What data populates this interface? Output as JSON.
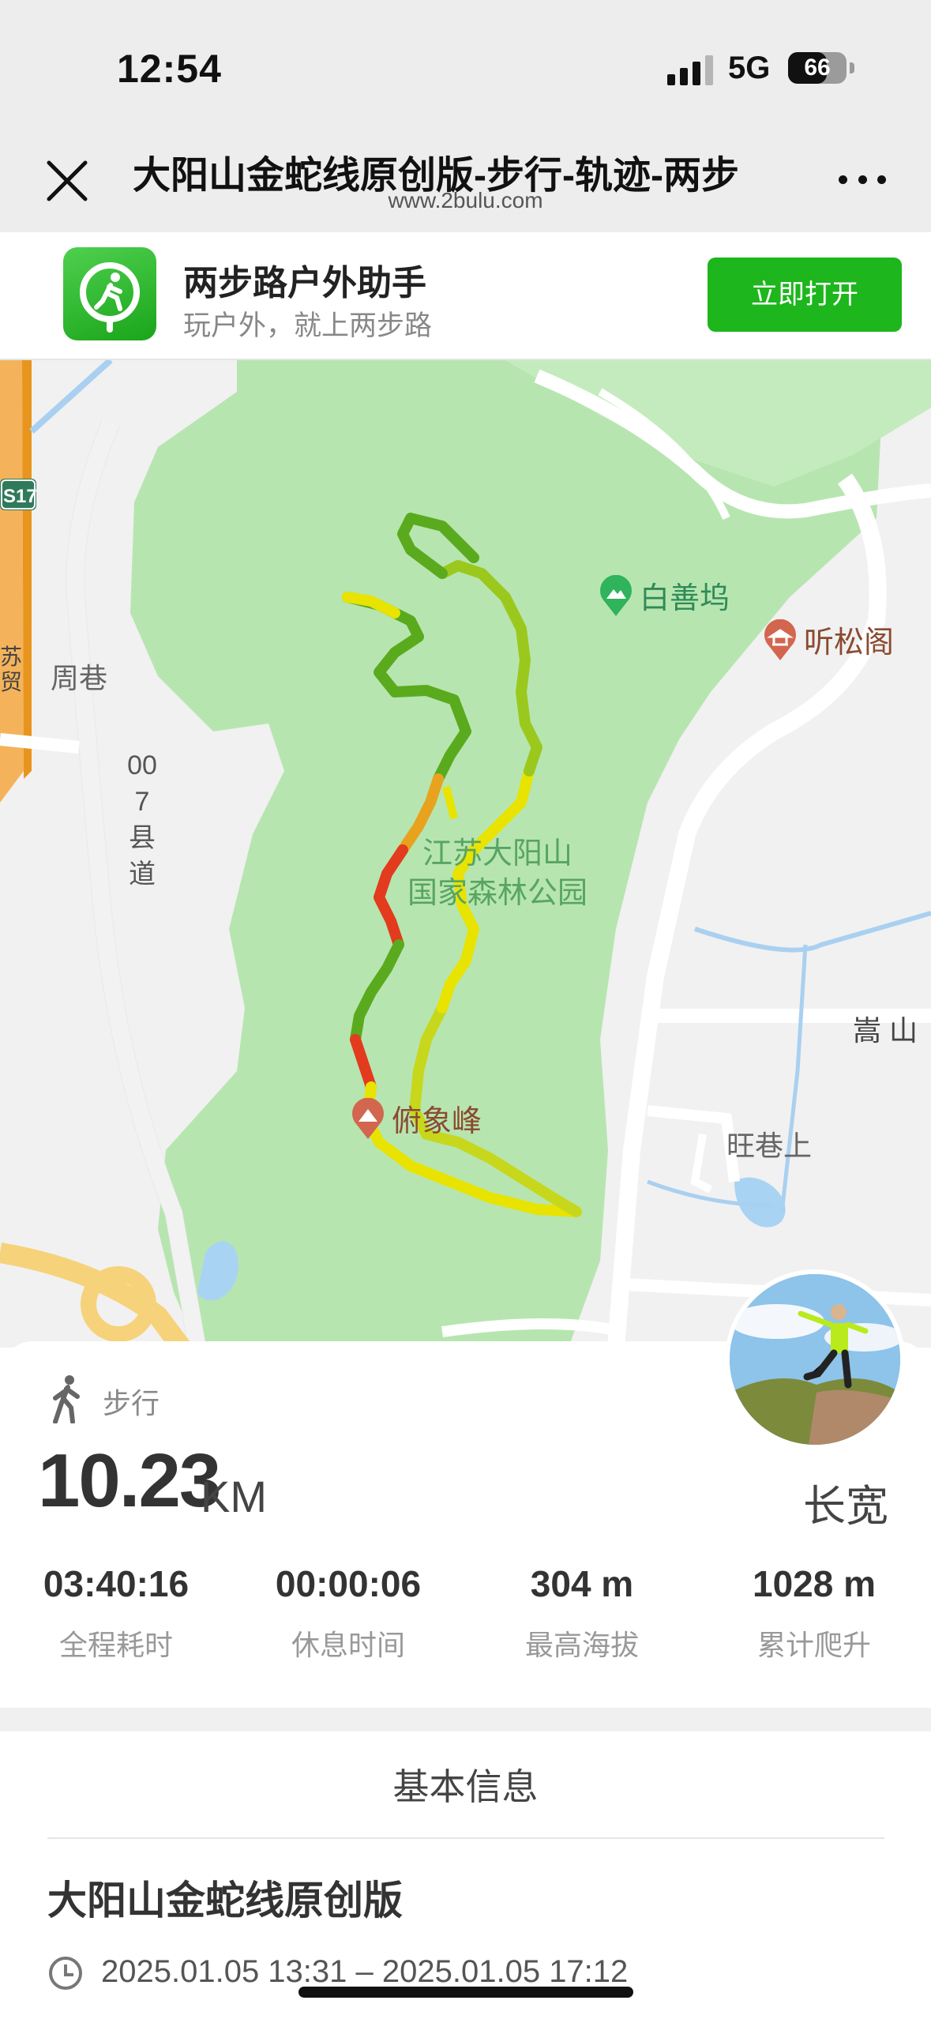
{
  "status_bar": {
    "time": "12:54",
    "network": "5G",
    "battery": "66",
    "battery_level": 0.66
  },
  "nav": {
    "title": "大阳山金蛇线原创版-步行-轨迹-两步",
    "url": "www.2bulu.com"
  },
  "app_banner": {
    "name": "两步路户外助手",
    "slogan": "玩户外，就上两步路",
    "open_label": "立即打开"
  },
  "map": {
    "park_line1": "江苏大阳山",
    "park_line2": "国家森林公园",
    "poi_baishanwu": "白善坞",
    "poi_tingsongge": "听松阁",
    "poi_fuxiangfeng": "俯象峰",
    "village_zhouxiang": "周巷",
    "village_wangxiangshang": "旺巷上",
    "place_songshan": "嵩 山",
    "highway_badge": "S17",
    "county_road": "007县道",
    "road_edge_text": "苏 \n 贸",
    "colors": {
      "park": "#b7e5b0",
      "track_fast": "#e8e300",
      "track_mid": "#5aaa1e",
      "track_slow": "#e23b1e"
    }
  },
  "stats": {
    "sport_type": "步行",
    "distance": "10.23",
    "distance_unit": "KM",
    "user_name": "长宽",
    "items": [
      {
        "value": "03:40:16",
        "label": "全程耗时"
      },
      {
        "value": "00:00:06",
        "label": "休息时间"
      },
      {
        "value": "304 m",
        "label": "最高海拔"
      },
      {
        "value": "1028 m",
        "label": "累计爬升"
      }
    ]
  },
  "basic_info": {
    "section_title": "基本信息",
    "track_name": "大阳山金蛇线原创版",
    "time_range": "2025.01.05 13:31 – 2025.01.05 17:12"
  }
}
